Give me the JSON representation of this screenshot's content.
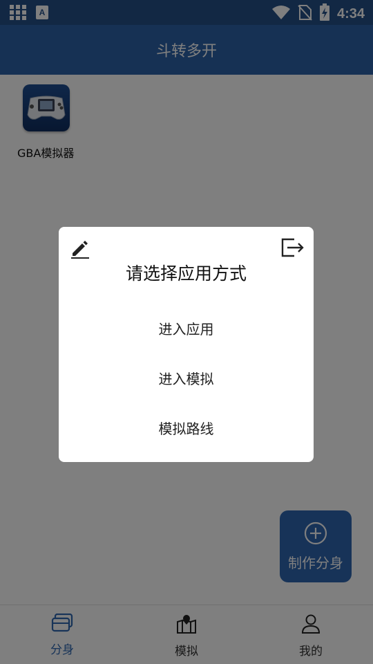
{
  "status_bar": {
    "time": "4:34",
    "left_icons": [
      "grid-app-icon",
      "font-a-icon"
    ],
    "right_icons": [
      "wifi-icon",
      "no-sim-icon",
      "battery-charging-icon"
    ]
  },
  "app_bar": {
    "title": "斗转多开"
  },
  "apps": [
    {
      "name": "GBA模拟器",
      "icon": "gameboy-advance-icon"
    }
  ],
  "fab": {
    "label": "制作分身",
    "icon": "plus-circle-icon"
  },
  "bottom_nav": {
    "items": [
      {
        "label": "分身",
        "icon": "cards-icon",
        "active": true
      },
      {
        "label": "模拟",
        "icon": "map-pin-icon",
        "active": false
      },
      {
        "label": "我的",
        "icon": "user-icon",
        "active": false
      }
    ]
  },
  "dialog": {
    "title": "请选择应用方式",
    "edit_icon": "pencil-icon",
    "exit_icon": "logout-icon",
    "options": [
      "进入应用",
      "进入模拟",
      "模拟路线"
    ]
  },
  "colors": {
    "status_bar": "#245089",
    "app_bar": "#2d63a8",
    "accent": "#2e67b1",
    "scrim": "rgba(0,0,0,0.5)"
  }
}
